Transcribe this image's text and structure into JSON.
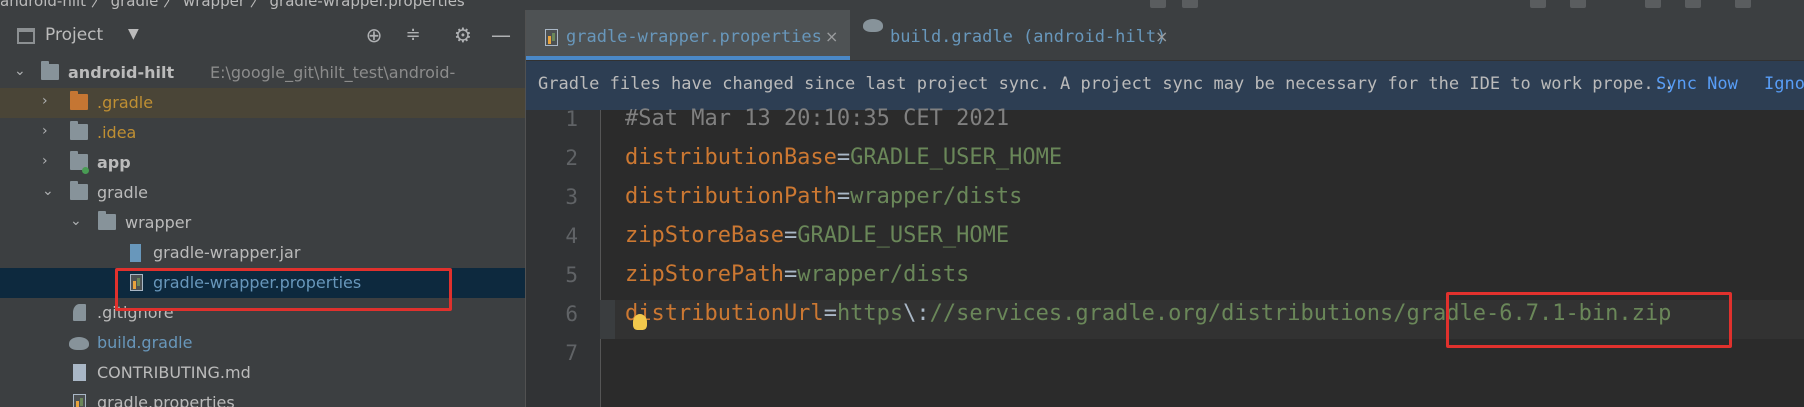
{
  "topbar": {
    "breadcrumb": "android-hilt 〉 gradle 〉 wrapper 〉 gradle-wrapper.properties"
  },
  "project_panel": {
    "title": "Project",
    "tree": [
      {
        "label": "android-hilt",
        "path": "E:\\google_git\\hilt_test\\android-",
        "color": "#bbbbbb",
        "bold": true
      },
      {
        "label": ".gradle",
        "color": "#bf8f33"
      },
      {
        "label": ".idea",
        "color": "#bf8f33"
      },
      {
        "label": "app",
        "color": "#bbbbbb",
        "bold": true
      },
      {
        "label": "gradle",
        "color": "#bbbbbb"
      },
      {
        "label": "wrapper",
        "color": "#bbbbbb"
      },
      {
        "label": "gradle-wrapper.jar",
        "color": "#bbbbbb"
      },
      {
        "label": "gradle-wrapper.properties",
        "color": "#6897bb"
      },
      {
        "label": ".gitignore",
        "color": "#bbbbbb"
      },
      {
        "label": "build.gradle",
        "color": "#6897bb"
      },
      {
        "label": "CONTRIBUTING.md",
        "color": "#bbbbbb"
      },
      {
        "label": "gradle.properties",
        "color": "#bbbbbb"
      }
    ]
  },
  "editor": {
    "tabs": [
      {
        "label": "gradle-wrapper.properties",
        "close": "×",
        "active": true
      },
      {
        "label": "build.gradle (android-hilt)",
        "close": "×",
        "active": false
      }
    ],
    "banner": {
      "message": "Gradle files have changed since last project sync. A project sync may be necessary for the IDE to work prope...",
      "sync_now": "Sync Now",
      "ignore": "Ignore"
    },
    "line_numbers": [
      "1",
      "2",
      "3",
      "4",
      "5",
      "6",
      "7"
    ],
    "lines": [
      {
        "comment": "#Sat Mar 13 20:10:35 CET 2021"
      },
      {
        "key": "distributionBase",
        "eq": "=",
        "value": "GRADLE_USER_HOME"
      },
      {
        "key": "distributionPath",
        "eq": "=",
        "value": "wrapper/dists"
      },
      {
        "key": "zipStoreBase",
        "eq": "=",
        "value": "GRADLE_USER_HOME"
      },
      {
        "key": "zipStorePath",
        "eq": "=",
        "value": "wrapper/dists"
      },
      {
        "key": "distributionUrl",
        "eq": "=",
        "value_a": "https",
        "esc": "\\:",
        "value_b": "//services.gradle.org/distributions/",
        "value_c": "gradle-6.7.1-bin.zip"
      }
    ]
  },
  "colors": {
    "accent": "#4a88c7",
    "highlight_box": "#e0312d",
    "link": "#589df6"
  }
}
